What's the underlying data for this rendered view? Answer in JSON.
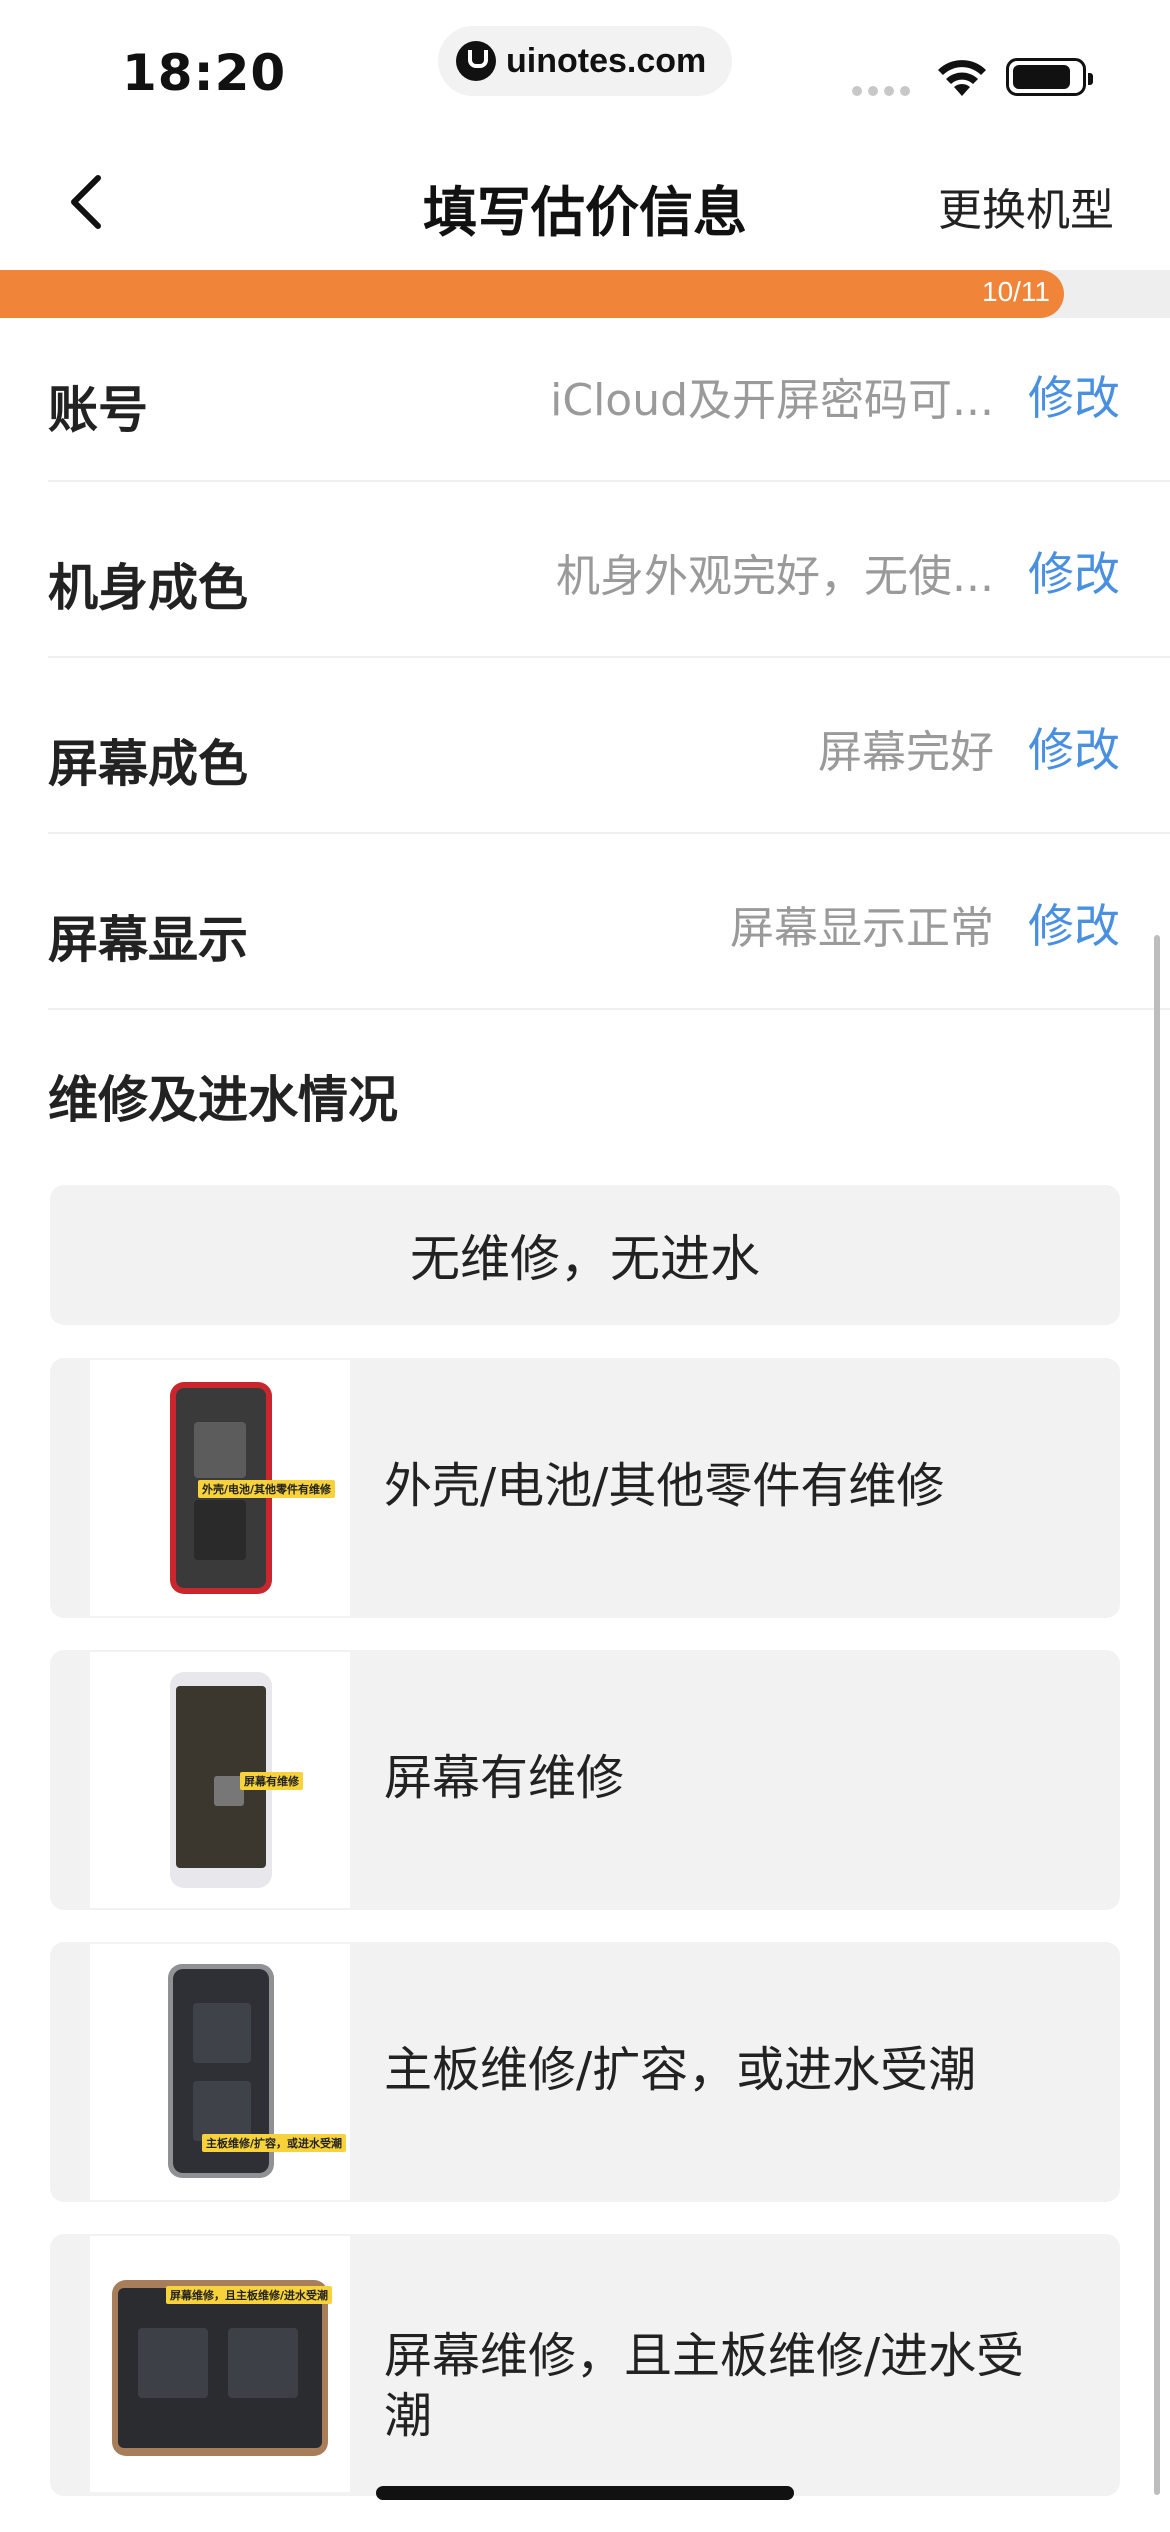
{
  "status_bar": {
    "time": "18:20",
    "url": "uinotes.com"
  },
  "nav": {
    "title": "填写估价信息",
    "action": "更换机型"
  },
  "progress": {
    "label": "10/11",
    "current": 10,
    "total": 11
  },
  "info_rows": [
    {
      "label": "账号",
      "value": "iCloud及开屏密码可...",
      "edit": "修改"
    },
    {
      "label": "机身成色",
      "value": "机身外观完好，无使...",
      "edit": "修改"
    },
    {
      "label": "屏幕成色",
      "value": "屏幕完好",
      "edit": "修改"
    },
    {
      "label": "屏幕显示",
      "value": "屏幕显示正常",
      "edit": "修改"
    }
  ],
  "section": {
    "title": "维修及进水情况"
  },
  "options": [
    {
      "label": "无维修，无进水"
    },
    {
      "label": "外壳/电池/其他零件有维修",
      "tag": "外壳/电池/其他零件有维修"
    },
    {
      "label": "屏幕有维修",
      "tag": "屏幕有维修"
    },
    {
      "label": "主板维修/扩容，或进水受潮",
      "tag": "主板维修/扩容，或进水受潮"
    },
    {
      "label": "屏幕维修，且主板维修/进水受潮",
      "tag": "屏幕维修，且主板维修/进水受潮"
    }
  ],
  "colors": {
    "accent_orange": "#f0853a",
    "link_blue": "#4a90e2",
    "card_bg": "#f2f2f2"
  },
  "icons": [
    "back-chevron-icon",
    "wifi-icon",
    "battery-icon",
    "cellular-signal-icon"
  ]
}
